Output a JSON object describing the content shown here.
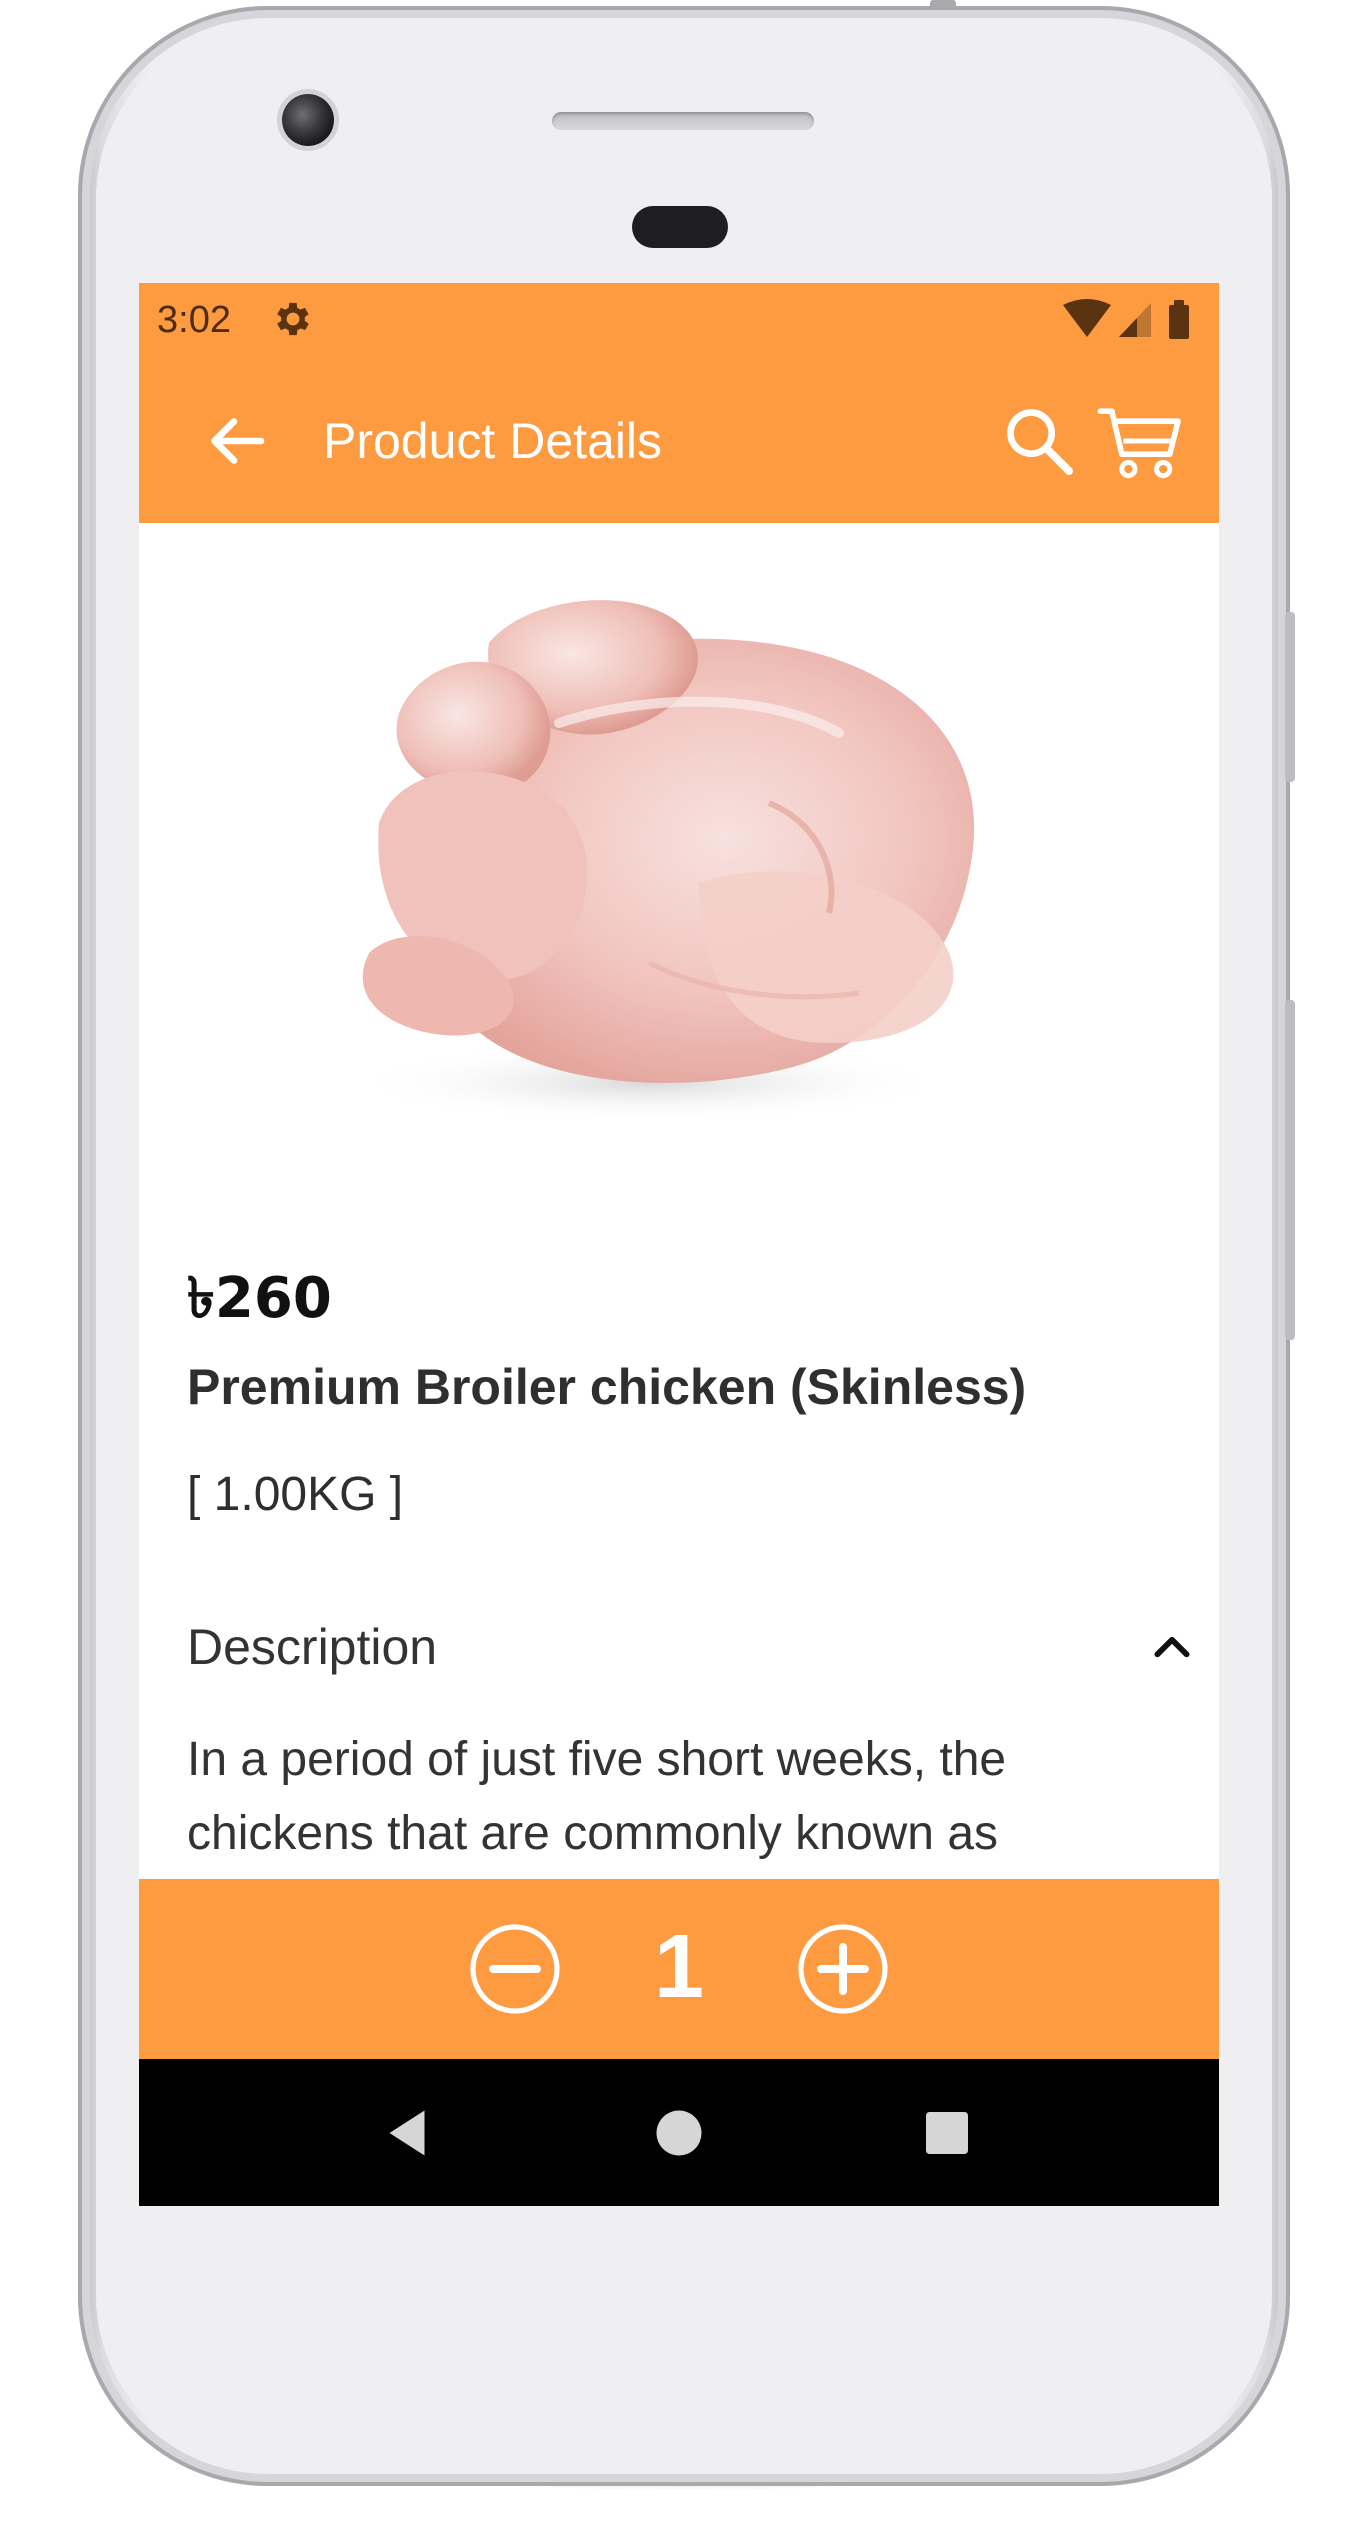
{
  "status_bar": {
    "time": "3:02",
    "settings_icon": "gear-icon",
    "wifi_icon": "wifi-icon",
    "signal_icon": "cell-signal-icon",
    "battery_icon": "battery-icon"
  },
  "app_bar": {
    "title": "Product Details",
    "back_icon": "arrow-left-icon",
    "search_icon": "search-icon",
    "cart_icon": "cart-icon"
  },
  "product": {
    "image_subject": "raw-whole-chicken",
    "price": "৳260",
    "name": "Premium Broiler chicken (Skinless)",
    "unit": "[ 1.00KG ]"
  },
  "description": {
    "title": "Description",
    "expanded": true,
    "text": "In a period of just five short weeks, the chickens that are commonly known as"
  },
  "quantity": {
    "value": "1",
    "decrement_icon": "minus-circle-icon",
    "increment_icon": "plus-circle-icon"
  },
  "navigation": {
    "back_icon": "nav-back-icon",
    "home_icon": "nav-home-icon",
    "recents_icon": "nav-recents-icon"
  },
  "colors": {
    "accent": "#fe9a3f",
    "text_dark": "#2f2f2f",
    "nav_bar": "#000000"
  }
}
